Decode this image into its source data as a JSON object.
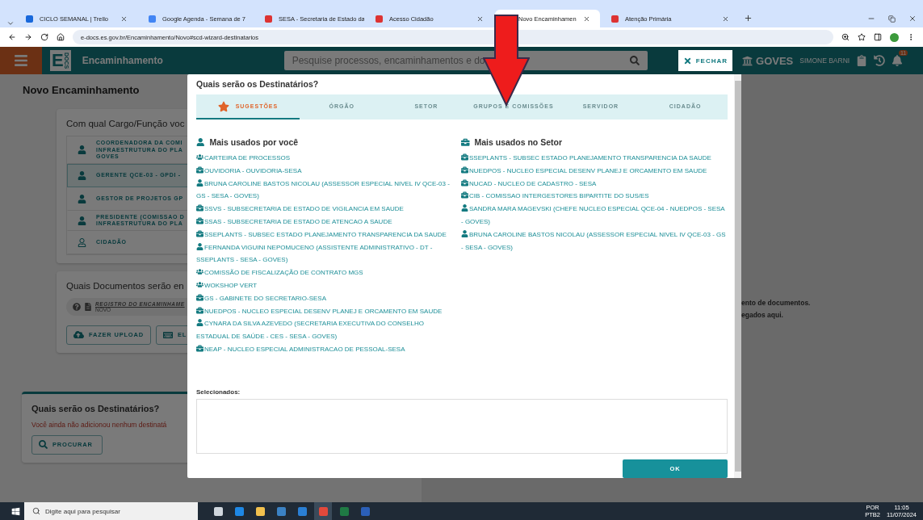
{
  "browser": {
    "tabs": [
      {
        "title": "CICLO SEMANAL | Trello",
        "selected": false
      },
      {
        "title": "Google Agenda - Semana de 7",
        "selected": false
      },
      {
        "title": "SESA - Secretaria de Estado da",
        "selected": false
      },
      {
        "title": "Acesso Cidadão",
        "selected": false
      },
      {
        "title": "Novo Encaminhamen",
        "selected": true
      },
      {
        "title": "Atenção Primária",
        "selected": false
      }
    ],
    "address": "e-docs.es.gov.br/Encaminhamento/Novo#scd-wizard-destinatarios"
  },
  "app": {
    "logo": "E",
    "logo_sub": "DOCS",
    "title": "Encaminhamento",
    "search_placeholder": "Pesquise processos, encaminhamentos e do",
    "close_button": "FECHAR",
    "org": "GOVES",
    "user": "SIMONE BARNI",
    "notification_count": "11"
  },
  "page": {
    "title": "Novo Encaminhamento",
    "role_card": {
      "title": "Com qual Cargo/Função voc",
      "roles": [
        {
          "lines": [
            "COORDENADORA DA COMI",
            "INFRAESTRUTURA DO PLA",
            "GOVES"
          ],
          "kind": "person",
          "selected": false
        },
        {
          "lines": [
            "GERENTE QCE-03 - GPDI -"
          ],
          "kind": "person",
          "selected": true
        },
        {
          "lines": [
            "GESTOR DE PROJETOS GP"
          ],
          "kind": "person",
          "selected": false
        },
        {
          "lines": [
            "PRESIDENTE (COMISSAO D",
            "INFRAESTRUTURA DO PLA"
          ],
          "kind": "person",
          "selected": false
        },
        {
          "lines": [
            "CIDADÃO"
          ],
          "kind": "citizen",
          "selected": false
        }
      ]
    },
    "documents_card": {
      "title": "Quais Documentos serão en",
      "document": {
        "name": "REGISTRO DO ENCAMINHAME",
        "status": "NOVO"
      },
      "buttons": [
        {
          "label": "FAZER UPLOAD",
          "kind": "upload"
        },
        {
          "label": "EL",
          "kind": "keyboard"
        }
      ]
    },
    "recipients_card": {
      "title": "Quais serão os Destinatários?",
      "warning": "Você ainda não adicionou nenhum destinatá",
      "button": "PROCURAR"
    },
    "info_lines": [
      "ento de documentos.",
      "egados aqui."
    ]
  },
  "dialog": {
    "title": "Quais serão os Destinatários?",
    "tabs": [
      {
        "label": "SUGESTÕES",
        "selected": true
      },
      {
        "label": "ÓRGÃO",
        "selected": false
      },
      {
        "label": "SETOR",
        "selected": false
      },
      {
        "label": "GRUPOS E COMISSÕES",
        "selected": false
      },
      {
        "label": "SERVIDOR",
        "selected": false
      },
      {
        "label": "CIDADÃO",
        "selected": false
      }
    ],
    "columns": [
      {
        "heading": "Mais usados por você",
        "kind": "person",
        "items": [
          {
            "kind": "group",
            "label": "CARTEIRA DE PROCESSOS"
          },
          {
            "kind": "sector",
            "label": "OUVIDORIA - OUVIDORIA-SESA"
          },
          {
            "kind": "person",
            "label": "BRUNA CAROLINE BASTOS NICOLAU (ASSESSOR ESPECIAL NIVEL IV QCE-03 - GS - SESA - GOVES)"
          },
          {
            "kind": "sector",
            "label": "SSVS - SUBSECRETARIA DE ESTADO DE VIGILANCIA EM SAUDE"
          },
          {
            "kind": "sector",
            "label": "SSAS - SUBSECRETARIA DE ESTADO DE ATENCAO A SAUDE"
          },
          {
            "kind": "sector",
            "label": "SSEPLANTS - SUBSEC ESTADO PLANEJAMENTO TRANSPARENCIA DA SAUDE"
          },
          {
            "kind": "person",
            "label": "FERNANDA VIGUINI NEPOMUCENO (ASSISTENTE ADMINISTRATIVO - DT - SSEPLANTS - SESA - GOVES)"
          },
          {
            "kind": "group",
            "label": "COMISSÃO DE FISCALIZAÇÃO DE CONTRATO MGS"
          },
          {
            "kind": "group",
            "label": "WOKSHOP VERT"
          },
          {
            "kind": "sector",
            "label": "GS - GABINETE DO SECRETARIO-SESA"
          },
          {
            "kind": "sector",
            "label": "NUEDPOS - NUCLEO ESPECIAL DESENV PLANEJ E ORCAMENTO EM SAUDE"
          },
          {
            "kind": "person",
            "label": "CYNARA DA SILVA AZEVEDO (SECRETARIA EXECUTIVA DO CONSELHO ESTADUAL DE SAÚDE - CES - SESA - GOVES)"
          },
          {
            "kind": "sector",
            "label": "NEAP - NUCLEO ESPECIAL ADMINISTRACAO DE PESSOAL-SESA"
          }
        ]
      },
      {
        "heading": "Mais usados no Setor",
        "kind": "sector",
        "items": [
          {
            "kind": "sector",
            "label": "SSEPLANTS - SUBSEC ESTADO PLANEJAMENTO TRANSPARENCIA DA SAUDE"
          },
          {
            "kind": "sector",
            "label": "NUEDPOS - NUCLEO ESPECIAL DESENV PLANEJ E ORCAMENTO EM SAUDE"
          },
          {
            "kind": "sector",
            "label": "NUCAD - NUCLEO DE CADASTRO - SESA"
          },
          {
            "kind": "sector",
            "label": "CIB - COMISSAO INTERGESTORES BIPARTITE DO SUS/ES"
          },
          {
            "kind": "person",
            "label": "SANDRA MARA MAGEVSKI (CHEFE NUCLEO ESPECIAL QCE-04 - NUEDPOS - SESA - GOVES)"
          },
          {
            "kind": "person",
            "label": "BRUNA CAROLINE BASTOS NICOLAU (ASSESSOR ESPECIAL NIVEL IV QCE-03 - GS - SESA - GOVES)"
          }
        ]
      }
    ],
    "selected_label": "Selecionados:",
    "ok_button": "OK"
  },
  "taskbar": {
    "search_placeholder": "Digite aqui para pesquisar",
    "language": "POR",
    "layout": "PTB2",
    "time": "11:05",
    "date": "11/07/2024"
  }
}
